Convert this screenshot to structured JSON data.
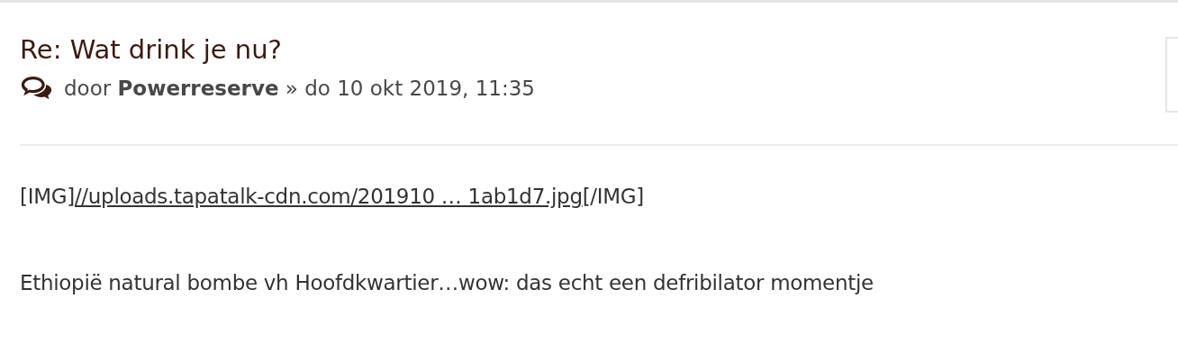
{
  "post": {
    "title": "Re: Wat drink je nu?",
    "meta": {
      "prefix": "door",
      "author": "Powerreserve",
      "separator": "»",
      "date": "do 10 okt 2019, 11:35"
    },
    "content": [
      {
        "kind": "link-line",
        "before": "[IMG]",
        "link": "//uploads.tapatalk-cdn.com/201910 … 1ab1d7.jpg",
        "after": "[/IMG]"
      },
      {
        "kind": "text",
        "text": "Ethiopië natural bombe vh Hoofdkwartier…wow: das echt een defribilator momentje"
      }
    ]
  }
}
